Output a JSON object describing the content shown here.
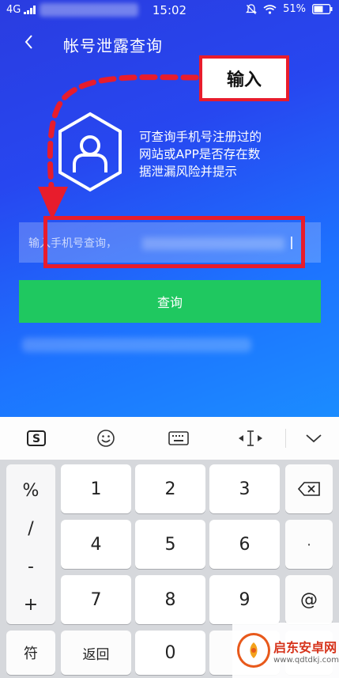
{
  "status_bar": {
    "network": "4G",
    "time": "15:02",
    "battery": "51%"
  },
  "header": {
    "back_icon": "chevron-left-icon",
    "title": "帐号泄露查询"
  },
  "annotation": {
    "label": "输入"
  },
  "description": {
    "lines": [
      "可查询手机号注册过的",
      "网站或APP是否存在数",
      "据泄漏风险并提示"
    ]
  },
  "search": {
    "placeholder": "输入手机号查询，"
  },
  "query_button": {
    "label": "查询"
  },
  "colors": {
    "accent_red": "#e81c2c",
    "button_green": "#1fc860",
    "background_blue": "#2747f0"
  },
  "keyboard": {
    "toolbar_icons": [
      "sogou-logo-icon",
      "emoji-icon",
      "keyboard-icon",
      "cursor-move-icon",
      "collapse-chevron-icon"
    ],
    "side_symbols": [
      "%",
      "/",
      "-",
      "+"
    ],
    "digits": {
      "r1": [
        "1",
        "2",
        "3"
      ],
      "r2": [
        "4",
        "5",
        "6"
      ],
      "r3": [
        "7",
        "8",
        "9"
      ],
      "zero": "0"
    },
    "right_keys": {
      "dot": "·",
      "at": "@"
    },
    "bottom": {
      "symbols": "符",
      "back": "返回"
    }
  },
  "watermark": {
    "name": "启东安卓网",
    "url": "www.qdtdkj.com"
  }
}
